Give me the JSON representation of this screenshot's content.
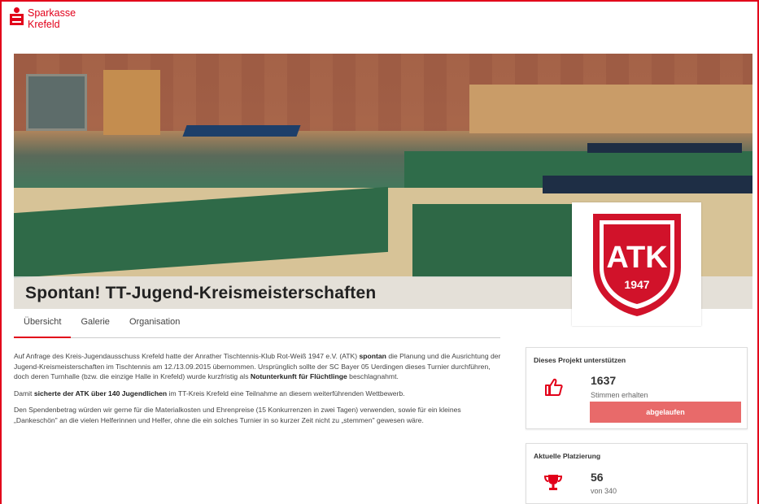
{
  "brand": {
    "line1": "Sparkasse",
    "line2": "Krefeld"
  },
  "hero": {
    "title": "Spontan! TT-Jugend-Kreismeisterschaften"
  },
  "logo": {
    "letters": "ATK",
    "year": "1947",
    "color": "#d1122a"
  },
  "tabs": [
    {
      "label": "Übersicht",
      "active": true
    },
    {
      "label": "Galerie",
      "active": false
    },
    {
      "label": "Organisation",
      "active": false
    }
  ],
  "content": {
    "p1_a": "Auf Anfrage des Kreis-Jugendausschuss Krefeld hatte der Anrather Tischtennis-Klub Rot-Weiß 1947 e.V. (ATK)",
    "p1_b": "spontan",
    "p1_c": "die Planung und die Ausrichtung der Jugend-Kreismeisterschaften im Tischtennis am 12./13.09.2015 übernommen. Ursprünglich sollte der SC Bayer 05 Uerdingen dieses Turnier durchführen, doch deren Turnhalle (bzw. die einzige Halle in Krefeld) wurde kurzfristig als",
    "p1_d": "Notunterkunft für Flüchtlinge",
    "p1_e": "beschlagnahmt.",
    "p2_a": "Damit",
    "p2_b": "sicherte der ATK über 140 Jugendlichen",
    "p2_c": "im TT-Kreis Krefeld eine Teilnahme an diesem weiterführenden Wettbewerb.",
    "p3": "Den Spendenbetrag würden wir gerne für die Materialkosten und Ehrenpreise (15 Konkurrenzen in zwei Tagen) verwenden, sowie für ein kleines „Dankeschön\" an die vielen Helferinnen und Helfer, ohne die ein solches Turnier in so kurzer Zeit nicht zu „stemmen\" gewesen wäre."
  },
  "support": {
    "title": "Dieses Projekt unterstützen",
    "count": "1637",
    "count_label": "Stimmen erhalten",
    "button": "abgelaufen",
    "accent": "#e2001a"
  },
  "ranking": {
    "title": "Aktuelle Platzierung",
    "place": "56",
    "of": "von 340"
  }
}
